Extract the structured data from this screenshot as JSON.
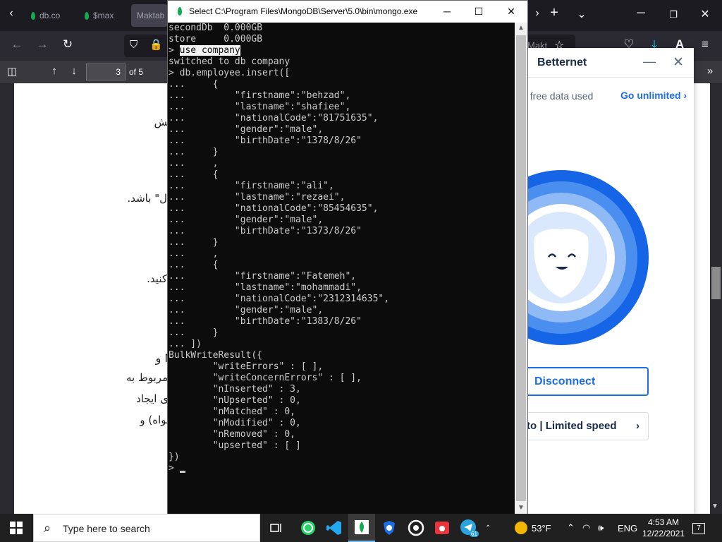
{
  "browser": {
    "tabs": [
      {
        "label": "db.co"
      },
      {
        "label": "$max"
      },
      {
        "label": "Maktab"
      }
    ],
    "new_tab_icon": "plus-icon",
    "list_tabs_icon": "chevron-down-icon",
    "window_controls": {
      "minimize": "─",
      "maximize": "❐",
      "close": "✕"
    },
    "partial_url_text": "Makt",
    "pdf": {
      "current_page": "3",
      "page_of": "of 5"
    }
  },
  "pdf_content": {
    "lines": [
      "خش",
      "ل\" باشد.",
      ".",
      "کنید.",
      "Mo و",
      "ت مربوط به",
      "عنای ایجاد",
      "دلخواه) و"
    ]
  },
  "betternet": {
    "title": "Betternet",
    "usage_text": "f free data used",
    "unlimited_link": "Go unlimited ›",
    "disconnect_label": "Disconnect",
    "upgrade_label": "to | Limited speed",
    "colors": {
      "accent": "#1c6ee8",
      "ring_outer": "#1565e6",
      "ring_mid": "#4a8ff0",
      "ring_inner": "#8fbaf6"
    }
  },
  "console": {
    "title": "Select C:\\Program Files\\MongoDB\\Server\\5.0\\bin\\mongo.exe",
    "lines": [
      "secondDb  0.000GB",
      "store     0.000GB",
      "> use company",
      "switched to db company",
      "> db.employee.insert([",
      "...     {",
      "...         \"firstname\":\"behzad\",",
      "...         \"lastname\":\"shafiee\",",
      "...         \"nationalCode\":\"81751635\",",
      "...         \"gender\":\"male\",",
      "...         \"birthDate\":\"1378/8/26\"",
      "...     }",
      "...     ,",
      "...     {",
      "...         \"firstname\":\"ali\",",
      "...         \"lastname\":\"rezaei\",",
      "...         \"nationalCode\":\"85454635\",",
      "...         \"gender\":\"male\",",
      "...         \"birthDate\":\"1373/8/26\"",
      "...     }",
      "...     ,",
      "...     {",
      "...         \"firstname\":\"Fatemeh\",",
      "...         \"lastname\":\"mohammadi\",",
      "...         \"nationalCode\":\"2312314635\",",
      "...         \"gender\":\"male\",",
      "...         \"birthDate\":\"1383/8/26\"",
      "...     }",
      "... ])",
      "BulkWriteResult({",
      "        \"writeErrors\" : [ ],",
      "        \"writeConcernErrors\" : [ ],",
      "        \"nInserted\" : 3,",
      "        \"nUpserted\" : 0,",
      "        \"nMatched\" : 0,",
      "        \"nModified\" : 0,",
      "        \"nRemoved\" : 0,",
      "        \"upserted\" : [ ]",
      "})",
      "> "
    ],
    "highlighted_command": "use company"
  },
  "taskbar": {
    "search_placeholder": "Type here to search",
    "weather": "53°F",
    "language": "ENG",
    "time": "4:53 AM",
    "date": "12/22/2021",
    "notification_count": "7",
    "telegram_badge": "61",
    "apps": [
      "task-view-icon",
      "whatsapp-icon",
      "vscode-icon",
      "mongodb-icon",
      "brave-icon",
      "obs-icon",
      "camera-icon",
      "telegram-icon"
    ]
  }
}
